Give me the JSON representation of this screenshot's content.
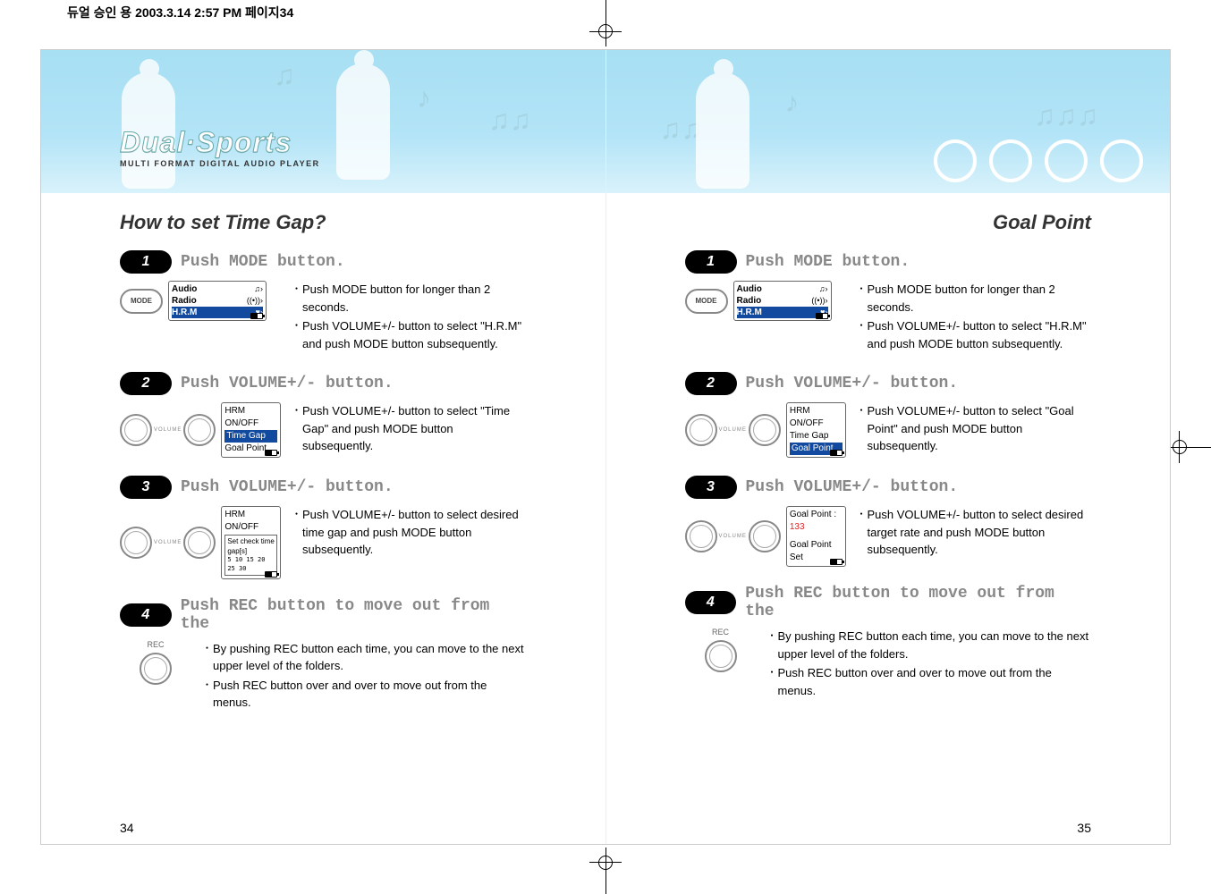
{
  "print_header": "듀얼 승인 용  2003.3.14 2:57 PM  페이지34",
  "brand": {
    "title": "Dual·Sports",
    "subtitle": "MULTI FORMAT DIGITAL AUDIO PLAYER"
  },
  "left_title": "How to set Time Gap?",
  "right_title": "Goal Point",
  "page_left": "34",
  "page_right": "35",
  "mode_button_label": "MODE",
  "rec_label": "REC",
  "vol_label": "VOLUME",
  "screen_mode": {
    "audio": "Audio",
    "radio": "Radio",
    "hrm": "H.R.M"
  },
  "screen_menu": {
    "hrm_onoff": "HRM ON/OFF",
    "time_gap": "Time Gap",
    "goal_point": "Goal Point"
  },
  "timegap_popup": {
    "label": "Set check time gap[s]",
    "values": "5 10 15 20 25 30"
  },
  "goal_screen": {
    "line1_prefix": "Goal Point : ",
    "line1_value": "133",
    "line2": "Goal Point Set"
  },
  "left": {
    "s1": {
      "title": "Push MODE button.",
      "b1": "Push MODE button for longer than 2 seconds.",
      "b2": "Push VOLUME+/- button to select \"H.R.M\" and push MODE button subsequently."
    },
    "s2": {
      "title": "Push VOLUME+/- button.",
      "b1": "Push VOLUME+/- button to select \"Time Gap\" and push MODE button subsequently."
    },
    "s3": {
      "title": "Push VOLUME+/- button.",
      "b1": "Push VOLUME+/- button to select desired time gap and push MODE button subsequently."
    },
    "s4": {
      "title": "Push REC button to move out from the",
      "b1": "By pushing REC button each time, you can move to the next upper level of the folders.",
      "b2": "Push REC button over and over to move out from the menus."
    }
  },
  "right": {
    "s1": {
      "title": "Push MODE button.",
      "b1": "Push MODE button for longer than 2 seconds.",
      "b2": "Push VOLUME+/- button to select \"H.R.M\" and push MODE button subsequently."
    },
    "s2": {
      "title": "Push VOLUME+/- button.",
      "b1": "Push VOLUME+/- button to select \"Goal Point\" and push MODE button subsequently."
    },
    "s3": {
      "title": "Push VOLUME+/- button.",
      "b1": "Push VOLUME+/- button to select desired target rate and push MODE button subsequently."
    },
    "s4": {
      "title": "Push REC button to move out from the",
      "b1": "By pushing REC button each time, you can move to the next upper level of the folders.",
      "b2": "Push REC button over and over to move out from the menus."
    }
  }
}
